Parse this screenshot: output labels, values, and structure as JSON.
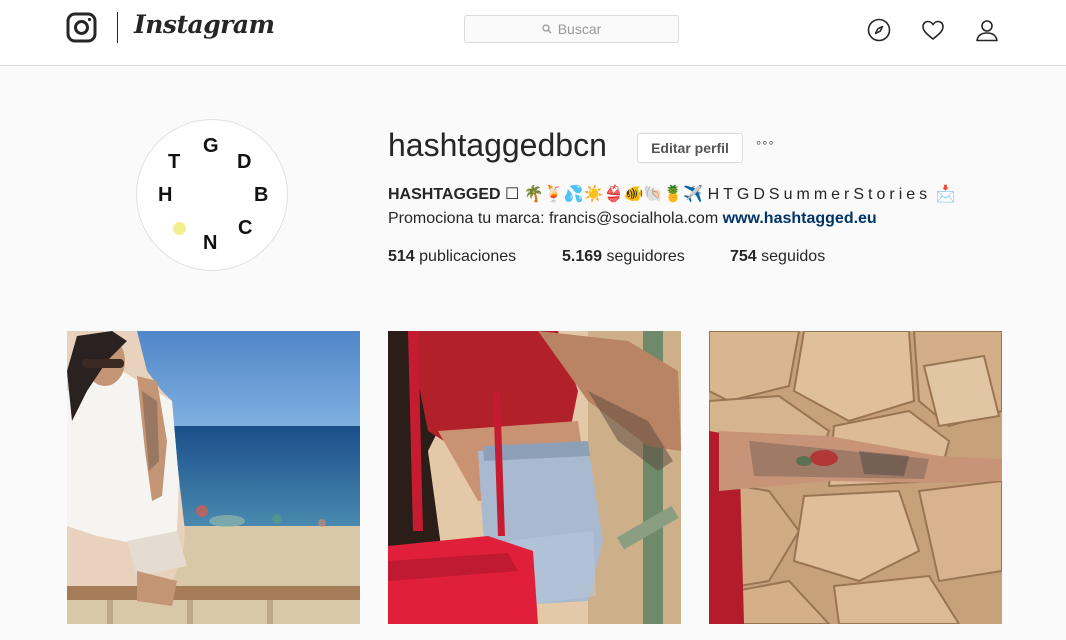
{
  "nav": {
    "wordmark": "Instagram",
    "search_placeholder": "Buscar",
    "icons": [
      "instagram-glyph-icon",
      "compass-icon",
      "heart-icon",
      "person-icon"
    ]
  },
  "profile": {
    "avatar_letters": [
      "T",
      "G",
      "D",
      "H",
      "B",
      "C",
      "N"
    ],
    "username": "hashtaggedbcn",
    "edit_label": "Editar perfil",
    "more_label": "°°°",
    "bio_name": "HASHTAGGED",
    "bio_emojis": "☐ 🌴🍹💦☀️👙🐠🐚🍍✈️",
    "bio_tag": "HTGDSummerStories",
    "bio_end_emoji": "📩",
    "bio_promo": "Promociona tu marca: francis@socialhola.com",
    "bio_link": "www.hashtagged.eu",
    "stats": [
      {
        "value": "514",
        "label": "publicaciones"
      },
      {
        "value": "5.169",
        "label": "seguidores"
      },
      {
        "value": "754",
        "label": "seguidos"
      }
    ]
  },
  "colors": {
    "link": "#003569",
    "text": "#262626",
    "border": "#dbdbdb",
    "background": "#fafafa"
  }
}
